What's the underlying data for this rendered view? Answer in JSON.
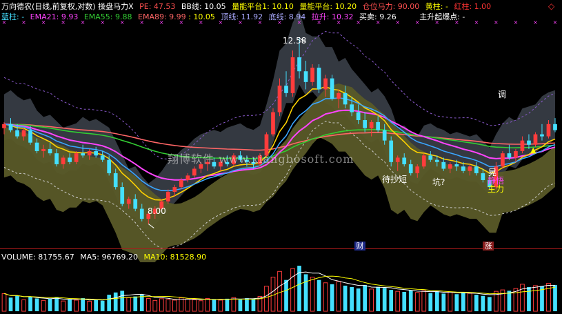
{
  "header": {
    "title": "万向德农(日线,前复权,对数) 操盘马力X",
    "pe_label": "PE: 47.53",
    "bb_label": "BB线: 10.05",
    "platform1_label": "量能平台1: 10.10",
    "platform_label": "量能平台: 10.20",
    "position_label": "仓位马力: 90.00",
    "yellow_label": "黄柱: -",
    "red_label": "红柱: 1.00",
    "blue_label": "蓝柱: -",
    "ema21_label": "EMA21: 9.93",
    "ema55_label": "EMA55: 9.88",
    "ema89_label": "EMA89: 9.99",
    "ema_extra": ": 10.05",
    "top_label": "顶线: 11.92",
    "bottom_label": "底线: 8.94",
    "pull_label": "拉升: 10.32",
    "buysell_label": "买卖: 9.26",
    "rise_label": "主升起爆点: -"
  },
  "annotations": {
    "high_price": "12.58",
    "low_price": "8.00",
    "buy_dip": "待抄短",
    "pit": "坑?",
    "adjust": "调",
    "dragon": "晃",
    "calm": "静悟",
    "main_force": "主力",
    "caption_mark": "财",
    "rise_mark": "涨",
    "watermark": "翔博软件 www.xiangbosoft.com"
  },
  "volume_header": {
    "volume_label": "VOLUME: 81755.67",
    "ma5_label": "MA5: 96769.20",
    "ma10_label": "MA10: 81528.90"
  },
  "colors": {
    "up": "#ff3c3c",
    "down": "#44e0ff",
    "ema21": "#ff44ff",
    "ema55": "#33cc33",
    "ema89": "#ff6666",
    "band": "#5a5a28",
    "cloud": "#3a3f48",
    "magenta": "#ff44ff"
  },
  "chart_data": {
    "type": "candlestick",
    "scale": "log",
    "price_high_label": 12.58,
    "price_low_label": 8.0,
    "candles": [
      [
        10.1,
        10.25,
        9.95,
        10.2
      ],
      [
        10.2,
        10.35,
        10.0,
        10.05
      ],
      [
        10.05,
        10.2,
        9.85,
        9.9
      ],
      [
        9.9,
        10.1,
        9.8,
        10.05
      ],
      [
        10.05,
        10.15,
        9.7,
        9.75
      ],
      [
        9.75,
        9.85,
        9.5,
        9.55
      ],
      [
        9.55,
        9.7,
        9.4,
        9.6
      ],
      [
        9.6,
        9.75,
        9.45,
        9.5
      ],
      [
        9.5,
        9.6,
        9.2,
        9.25
      ],
      [
        9.25,
        9.45,
        9.15,
        9.4
      ],
      [
        9.4,
        9.5,
        9.25,
        9.3
      ],
      [
        9.3,
        9.55,
        9.25,
        9.5
      ],
      [
        9.5,
        9.7,
        9.4,
        9.45
      ],
      [
        9.45,
        9.6,
        9.35,
        9.55
      ],
      [
        9.55,
        9.65,
        9.4,
        9.45
      ],
      [
        9.45,
        9.55,
        9.3,
        9.35
      ],
      [
        9.35,
        9.45,
        9.0,
        9.05
      ],
      [
        9.05,
        9.15,
        8.7,
        8.75
      ],
      [
        8.75,
        8.85,
        8.35,
        8.4
      ],
      [
        8.4,
        8.55,
        8.3,
        8.5
      ],
      [
        8.5,
        8.6,
        8.25,
        8.3
      ],
      [
        8.3,
        8.4,
        8.05,
        8.1
      ],
      [
        8.1,
        8.25,
        8.0,
        8.2
      ],
      [
        8.2,
        8.35,
        8.1,
        8.3
      ],
      [
        8.3,
        8.5,
        8.25,
        8.45
      ],
      [
        8.45,
        8.7,
        8.4,
        8.65
      ],
      [
        8.65,
        8.8,
        8.55,
        8.75
      ],
      [
        8.75,
        8.95,
        8.7,
        8.9
      ],
      [
        8.9,
        9.05,
        8.85,
        9.0
      ],
      [
        9.0,
        9.2,
        8.95,
        9.15
      ],
      [
        9.15,
        9.3,
        9.05,
        9.25
      ],
      [
        9.25,
        9.35,
        9.1,
        9.3
      ],
      [
        9.3,
        9.4,
        9.15,
        9.2
      ],
      [
        9.2,
        9.35,
        9.1,
        9.3
      ],
      [
        9.3,
        9.45,
        9.2,
        9.25
      ],
      [
        9.25,
        9.5,
        9.2,
        9.45
      ],
      [
        9.45,
        9.55,
        9.3,
        9.35
      ],
      [
        9.35,
        9.45,
        9.2,
        9.3
      ],
      [
        9.3,
        9.4,
        9.15,
        9.25
      ],
      [
        9.25,
        9.5,
        9.2,
        9.45
      ],
      [
        9.45,
        10.0,
        9.4,
        9.95
      ],
      [
        9.95,
        10.6,
        9.9,
        10.5
      ],
      [
        10.5,
        11.4,
        10.4,
        11.2
      ],
      [
        11.2,
        11.6,
        10.9,
        11.0
      ],
      [
        11.0,
        12.2,
        10.9,
        12.0
      ],
      [
        12.0,
        12.58,
        11.4,
        11.6
      ],
      [
        11.6,
        11.9,
        11.1,
        11.3
      ],
      [
        11.3,
        11.8,
        11.2,
        11.7
      ],
      [
        11.7,
        11.8,
        11.0,
        11.1
      ],
      [
        11.1,
        11.5,
        10.9,
        11.4
      ],
      [
        11.4,
        11.5,
        10.8,
        10.85
      ],
      [
        10.85,
        11.1,
        10.6,
        11.0
      ],
      [
        11.0,
        11.2,
        10.6,
        10.7
      ],
      [
        10.7,
        10.9,
        10.4,
        10.5
      ],
      [
        10.5,
        10.7,
        10.2,
        10.3
      ],
      [
        10.3,
        10.5,
        10.0,
        10.1
      ],
      [
        10.1,
        10.3,
        9.9,
        10.25
      ],
      [
        10.25,
        10.4,
        10.0,
        10.05
      ],
      [
        10.05,
        10.2,
        9.7,
        9.8
      ],
      [
        9.8,
        9.9,
        9.2,
        9.3
      ],
      [
        9.3,
        9.45,
        9.1,
        9.4
      ],
      [
        9.4,
        9.5,
        9.2,
        9.25
      ],
      [
        9.25,
        9.35,
        9.0,
        9.05
      ],
      [
        9.05,
        9.25,
        8.95,
        9.2
      ],
      [
        9.2,
        9.5,
        9.15,
        9.45
      ],
      [
        9.45,
        9.55,
        9.3,
        9.35
      ],
      [
        9.35,
        9.45,
        9.2,
        9.3
      ],
      [
        9.3,
        9.4,
        9.1,
        9.15
      ],
      [
        9.15,
        9.3,
        9.05,
        9.25
      ],
      [
        9.25,
        9.35,
        9.1,
        9.2
      ],
      [
        9.2,
        9.3,
        9.05,
        9.1
      ],
      [
        9.1,
        9.25,
        9.0,
        9.2
      ],
      [
        9.2,
        9.3,
        9.0,
        9.05
      ],
      [
        9.05,
        9.15,
        8.85,
        8.9
      ],
      [
        8.9,
        9.0,
        8.7,
        8.75
      ],
      [
        8.75,
        9.3,
        8.7,
        9.2
      ],
      [
        9.2,
        9.55,
        9.15,
        9.5
      ],
      [
        9.5,
        9.7,
        9.35,
        9.4
      ],
      [
        9.4,
        9.6,
        9.3,
        9.55
      ],
      [
        9.55,
        9.9,
        9.5,
        9.8
      ],
      [
        9.8,
        9.95,
        9.6,
        9.7
      ],
      [
        9.7,
        10.0,
        9.65,
        9.95
      ],
      [
        9.95,
        10.2,
        9.8,
        9.9
      ],
      [
        9.9,
        10.3,
        9.85,
        10.2
      ],
      [
        10.2,
        10.35,
        10.0,
        10.05
      ]
    ],
    "volumes": [
      62,
      48,
      55,
      40,
      52,
      45,
      38,
      44,
      50,
      36,
      42,
      39,
      46,
      35,
      41,
      37,
      58,
      66,
      72,
      48,
      52,
      60,
      45,
      38,
      44,
      41,
      39,
      47,
      43,
      40,
      37,
      45,
      42,
      39,
      44,
      48,
      41,
      46,
      43,
      52,
      88,
      120,
      140,
      110,
      150,
      160,
      130,
      120,
      110,
      100,
      95,
      105,
      90,
      85,
      80,
      92,
      78,
      86,
      82,
      75,
      70,
      68,
      74,
      66,
      72,
      64,
      70,
      62,
      68,
      60,
      66,
      63,
      58,
      54,
      50,
      70,
      75,
      72,
      80,
      95,
      85,
      90,
      88,
      98,
      92
    ],
    "x_label": "",
    "y_label": ""
  }
}
